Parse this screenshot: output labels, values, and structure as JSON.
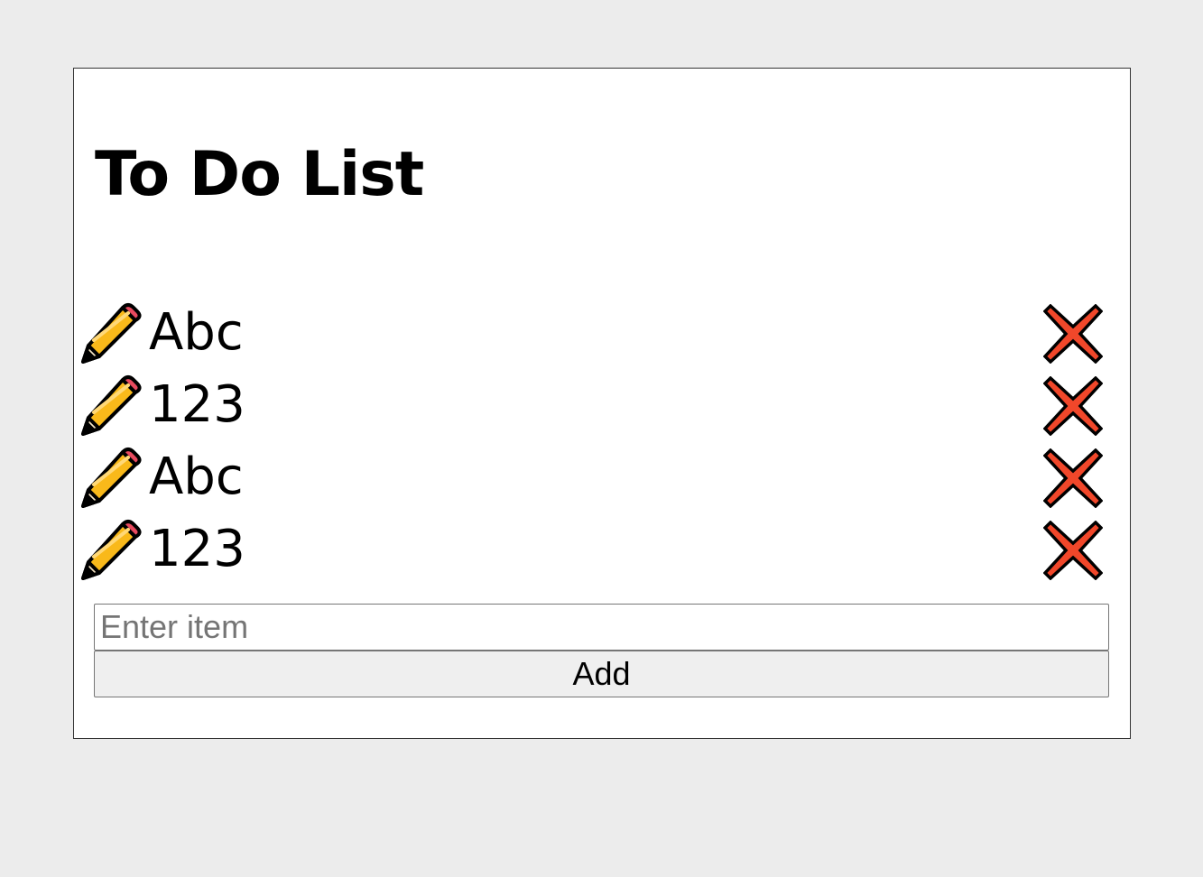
{
  "title": "To Do List",
  "items": [
    {
      "text": "Abc"
    },
    {
      "text": "123"
    },
    {
      "text": "Abc"
    },
    {
      "text": "123"
    }
  ],
  "input": {
    "value": "",
    "placeholder": "Enter item"
  },
  "add_button": {
    "label": "Add"
  },
  "icons": {
    "edit": "pencil-icon",
    "delete": "cross-mark-icon"
  },
  "colors": {
    "background": "#ececec",
    "card": "#ffffff",
    "pencil_body": "#f9b91a",
    "pencil_eraser": "#e84a5f",
    "cross": "#f1472a"
  }
}
